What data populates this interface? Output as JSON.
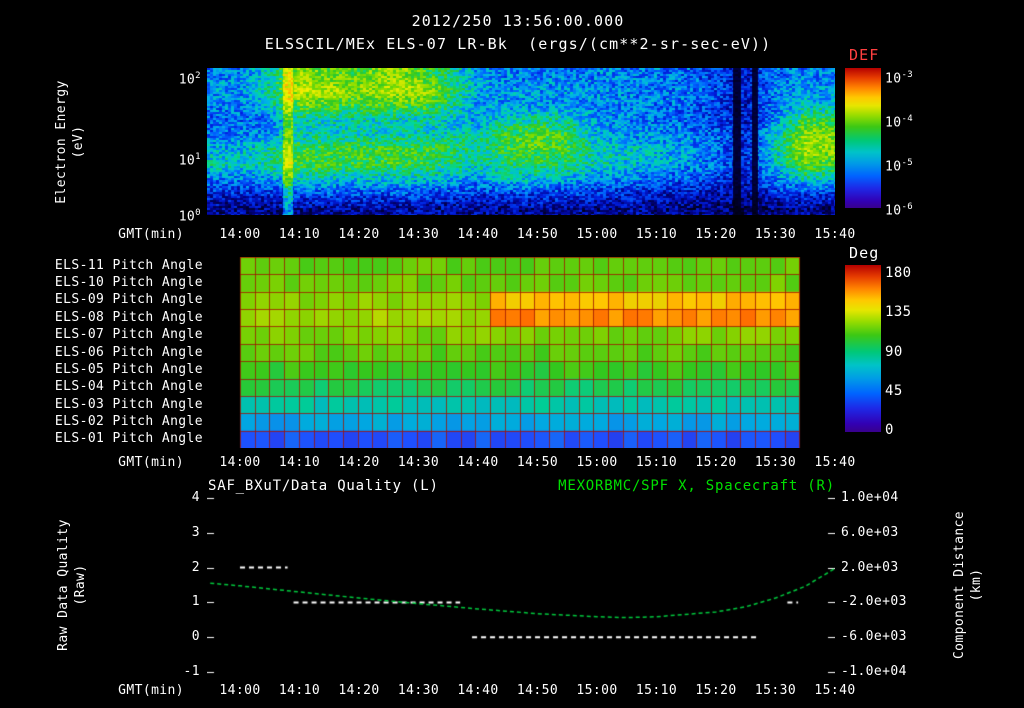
{
  "header": {
    "timestamp": "2012/250 13:56:00.000"
  },
  "colors": {
    "def_label": "#ff4040",
    "spacecraft_green": "#00e000",
    "quality_white": "#ffffff",
    "pitch_grid_red": "#a01400"
  },
  "time_axis": {
    "label": "GMT(min)",
    "tick_labels": [
      "14:00",
      "14:10",
      "14:20",
      "14:30",
      "14:40",
      "14:50",
      "15:00",
      "15:10",
      "15:20",
      "15:30",
      "15:40"
    ],
    "tick_minutes": [
      0,
      10,
      20,
      30,
      40,
      50,
      60,
      70,
      80,
      90,
      100
    ]
  },
  "chart_data": [
    {
      "type": "heatmap",
      "title": "ELSSCIL/MEx ELS-07 LR-Bk  (ergs/(cm**2-sr-sec-eV))",
      "ylabel": "Electron Energy\n(eV)",
      "xlabel": "GMT(min)",
      "y_scale": "log",
      "y_tick_labels": [
        "10^2",
        "10^1",
        "10^0"
      ],
      "energy_rows_eV": [
        100,
        60,
        36,
        22,
        13,
        7.7,
        4.6,
        2.8,
        1.7,
        1.0
      ],
      "time_columns_min": [
        0,
        5,
        10,
        15,
        20,
        25,
        30,
        35,
        40,
        45,
        50,
        55,
        60,
        65,
        70,
        75,
        80,
        85,
        90,
        95,
        100
      ],
      "value_scale": "relative log10 flux, 0 = 1e-6, 6 = 1e-3 ergs/(cm**2-sr-sec-eV)",
      "values": [
        [
          2.2,
          2.4,
          2.2,
          2.0,
          2.2,
          2.6,
          3.0,
          2.2,
          1.4,
          0.8
        ],
        [
          3.0,
          3.2,
          2.8,
          2.2,
          2.4,
          3.2,
          3.2,
          2.4,
          1.5,
          0.8
        ],
        [
          4.6,
          5.0,
          4.2,
          3.0,
          3.0,
          3.8,
          4.0,
          3.0,
          1.8,
          0.9
        ],
        [
          4.2,
          4.8,
          4.0,
          3.0,
          3.0,
          3.8,
          3.8,
          2.8,
          1.8,
          0.9
        ],
        [
          4.0,
          4.4,
          3.8,
          3.0,
          3.0,
          3.8,
          3.8,
          2.8,
          1.8,
          0.9
        ],
        [
          4.6,
          4.8,
          4.0,
          3.0,
          3.0,
          3.8,
          3.8,
          2.8,
          1.8,
          0.9
        ],
        [
          4.2,
          4.8,
          4.0,
          3.0,
          3.0,
          3.8,
          3.8,
          2.8,
          1.8,
          0.9
        ],
        [
          3.2,
          3.8,
          3.4,
          2.8,
          3.0,
          3.6,
          3.4,
          2.6,
          1.7,
          0.9
        ],
        [
          2.4,
          2.6,
          2.4,
          2.4,
          3.0,
          3.2,
          3.0,
          2.4,
          1.6,
          0.8
        ],
        [
          2.2,
          2.4,
          2.4,
          3.0,
          3.8,
          3.8,
          3.4,
          2.8,
          1.7,
          0.8
        ],
        [
          2.2,
          2.4,
          2.4,
          3.2,
          4.0,
          4.0,
          3.6,
          2.8,
          1.7,
          0.8
        ],
        [
          2.2,
          2.4,
          2.4,
          3.0,
          3.8,
          3.8,
          3.4,
          2.6,
          1.6,
          0.8
        ],
        [
          2.2,
          2.3,
          2.2,
          2.4,
          2.6,
          3.0,
          3.0,
          2.2,
          1.5,
          0.8
        ],
        [
          2.2,
          2.3,
          2.2,
          2.2,
          2.4,
          2.8,
          2.8,
          2.2,
          1.4,
          0.8
        ],
        [
          2.1,
          2.2,
          2.1,
          2.1,
          2.3,
          2.7,
          2.6,
          2.0,
          1.3,
          0.8
        ],
        [
          2.0,
          2.1,
          2.0,
          2.0,
          2.2,
          2.5,
          2.4,
          1.9,
          1.2,
          0.7
        ],
        [
          1.6,
          1.8,
          1.6,
          1.6,
          1.9,
          2.1,
          2.0,
          1.6,
          1.0,
          0.6
        ],
        [
          1.2,
          1.3,
          1.2,
          1.2,
          1.3,
          1.4,
          1.4,
          1.2,
          0.9,
          0.5
        ],
        [
          2.0,
          2.2,
          2.2,
          2.4,
          2.8,
          3.0,
          2.8,
          2.2,
          1.4,
          0.7
        ],
        [
          2.2,
          2.4,
          2.8,
          3.8,
          4.6,
          4.8,
          4.2,
          3.0,
          1.6,
          0.8
        ],
        [
          2.2,
          2.4,
          2.8,
          3.6,
          4.4,
          4.4,
          4.0,
          2.8,
          1.6,
          0.8
        ]
      ],
      "streaks": [
        {
          "t_min": 8,
          "width_min": 1.6,
          "boost": 1.4
        }
      ],
      "gaps": [
        {
          "t_min": 83.5,
          "width_min": 1.4
        },
        {
          "t_min": 86.5,
          "width_min": 1.1
        }
      ],
      "colorbar": {
        "label": "DEF",
        "tick_labels": [
          "10^-3",
          "10^-4",
          "10^-5",
          "10^-6"
        ]
      }
    },
    {
      "type": "heatmap",
      "rows": [
        "ELS-11 Pitch Angle",
        "ELS-10 Pitch Angle",
        "ELS-09 Pitch Angle",
        "ELS-08 Pitch Angle",
        "ELS-07 Pitch Angle",
        "ELS-06 Pitch Angle",
        "ELS-05 Pitch Angle",
        "ELS-04 Pitch Angle",
        "ELS-03 Pitch Angle",
        "ELS-02 Pitch Angle",
        "ELS-01 Pitch Angle"
      ],
      "xlabel": "GMT(min)",
      "units": "Deg",
      "data_time_range_min": [
        0,
        94
      ],
      "cells_per_row": 38,
      "row_values": [
        [
          [
            0,
            94,
            100
          ]
        ],
        [
          [
            0,
            94,
            102
          ]
        ],
        [
          [
            0,
            42,
            110
          ],
          [
            42,
            94,
            138
          ]
        ],
        [
          [
            0,
            42,
            114
          ],
          [
            42,
            94,
            150
          ]
        ],
        [
          [
            0,
            94,
            106
          ]
        ],
        [
          [
            0,
            94,
            98
          ]
        ],
        [
          [
            0,
            94,
            90
          ]
        ],
        [
          [
            0,
            94,
            80
          ]
        ],
        [
          [
            0,
            94,
            64
          ]
        ],
        [
          [
            0,
            94,
            50
          ]
        ],
        [
          [
            0,
            94,
            30
          ]
        ]
      ],
      "colorbar": {
        "label": "Deg",
        "tick_labels": [
          "180",
          "135",
          "90",
          "45",
          "0"
        ],
        "range": [
          0,
          180
        ]
      }
    },
    {
      "type": "line",
      "title_left": "SAF_BXuT/Data Quality (L)",
      "title_right": "MEXORBMC/SPF X, Spacecraft (R)",
      "ylabel_left": "Raw Data Quality\n(Raw)",
      "ylabel_right": "Component Distance\n(km)",
      "xlabel": "GMT(min)",
      "y_left_range": [
        -1,
        4
      ],
      "y_left_tick_values": [
        4,
        3,
        2,
        1,
        0,
        -1
      ],
      "y_left_tick_labels": [
        "4",
        "3",
        "2",
        "1",
        "0",
        "-1"
      ],
      "y_right_range": [
        -10000,
        10000
      ],
      "y_right_tick_values": [
        10000,
        6000,
        2000,
        -2000,
        -6000,
        -10000
      ],
      "y_right_tick_labels": [
        "1.0e+04",
        "6.0e+03",
        "2.0e+03",
        "-2.0e+03",
        "-6.0e+03",
        "-1.0e+04"
      ],
      "series": [
        {
          "name": "SAF_BXuT/Data Quality",
          "axis": "left",
          "color": "#ffffff",
          "line_style": "dashed",
          "segments": [
            {
              "t_start_min": 0,
              "t_end_min": 8,
              "value": 2
            },
            {
              "t_start_min": 9,
              "t_end_min": 37,
              "value": 1
            },
            {
              "t_start_min": 39,
              "t_end_min": 87,
              "value": 0
            },
            {
              "t_start_min": 92,
              "t_end_min": 93.8,
              "value": 1
            }
          ]
        },
        {
          "name": "MEXORBMC/SPF X, Spacecraft",
          "axis": "right",
          "color": "#00c83c",
          "line_style": "dashed",
          "points": [
            [
              -5,
              200
            ],
            [
              0,
              -100
            ],
            [
              10,
              -800
            ],
            [
              20,
              -1500
            ],
            [
              30,
              -2150
            ],
            [
              40,
              -2750
            ],
            [
              50,
              -3300
            ],
            [
              60,
              -3650
            ],
            [
              65,
              -3750
            ],
            [
              70,
              -3650
            ],
            [
              80,
              -3100
            ],
            [
              85,
              -2500
            ],
            [
              90,
              -1500
            ],
            [
              95,
              -150
            ],
            [
              100,
              1900
            ]
          ]
        }
      ]
    }
  ]
}
